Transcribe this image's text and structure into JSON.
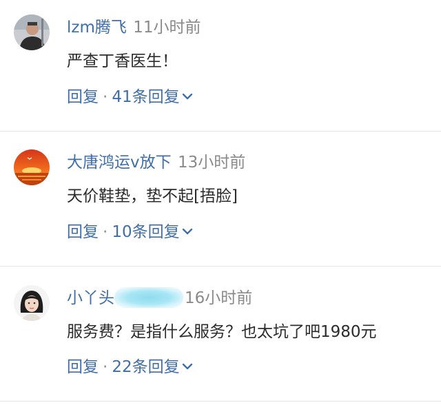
{
  "comments": [
    {
      "username": "lzm腾飞",
      "time": "11小时前",
      "text": "严查丁香医生！",
      "reply_label": "回复",
      "separator": "·",
      "replies_label": "41条回复",
      "avatar_icon": "avatar-man-photo"
    },
    {
      "username": "大唐鸿运v放下",
      "time": "13小时前",
      "text": "天价鞋垫，垫不起[捂脸]",
      "reply_label": "回复",
      "separator": "·",
      "replies_label": "10条回复",
      "avatar_icon": "avatar-sunset-photo"
    },
    {
      "username": "小丫头",
      "time": "16小时前",
      "text": "服务费？是指什么服务？也太坑了吧1980元",
      "reply_label": "回复",
      "separator": "·",
      "replies_label": "22条回复",
      "avatar_icon": "avatar-woman-photo"
    }
  ],
  "colors": {
    "username": "#3f6ea8",
    "time": "#8a8a8a",
    "text": "#2b2b2b",
    "divider": "#e6e6e6"
  }
}
